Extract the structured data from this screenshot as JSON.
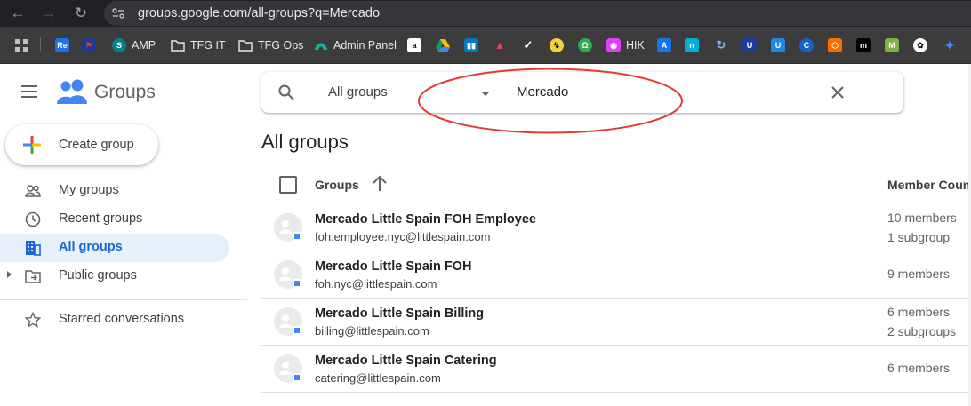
{
  "browser": {
    "url": "groups.google.com/all-groups?q=Mercado",
    "bookmarks": [
      {
        "icon": "apps-grid-icon",
        "label": ""
      },
      {
        "icon": "re-icon",
        "label": "",
        "badge": "Re",
        "color": "#1a73e8"
      },
      {
        "icon": "mlb-icon",
        "label": "",
        "color": "#1e3a8a"
      },
      {
        "icon": "sharepoint-icon",
        "label": "AMP",
        "color": "#038387"
      },
      {
        "icon": "folder-icon",
        "label": "TFG IT"
      },
      {
        "icon": "folder-icon",
        "label": "TFG Ops"
      },
      {
        "icon": "admin-panel-icon",
        "label": "Admin Panel",
        "color": "#00bfa5"
      },
      {
        "icon": "amazon-icon",
        "label": "",
        "color": "#ffffff"
      },
      {
        "icon": "drive-icon",
        "label": "",
        "color": "#0f9d58"
      },
      {
        "icon": "trello-icon",
        "label": "",
        "color": "#0079bf"
      },
      {
        "icon": "monday-icon",
        "label": "",
        "color": "#ff3d57"
      },
      {
        "icon": "check-icon",
        "label": "",
        "color": "#ffffff"
      },
      {
        "icon": "bolt-icon",
        "label": "",
        "color": "#f4d03f"
      },
      {
        "icon": "green-circle-icon",
        "label": "",
        "color": "#34a853"
      },
      {
        "icon": "hik-icon",
        "label": "HIK",
        "color": "#e040fb"
      },
      {
        "icon": "translate-icon",
        "label": "",
        "color": "#1a73e8"
      },
      {
        "icon": "n-icon",
        "label": "",
        "color": "#00b0d8"
      },
      {
        "icon": "swirl-icon",
        "label": "",
        "color": "#8ab4f8"
      },
      {
        "icon": "u-dark-icon",
        "label": "",
        "color": "#1a3e9a"
      },
      {
        "icon": "u-light-icon",
        "label": "",
        "color": "#1e88e5"
      },
      {
        "icon": "c-icon",
        "label": "",
        "color": "#1565c0"
      },
      {
        "icon": "orange-hex-icon",
        "label": "",
        "color": "#ff6d00"
      },
      {
        "icon": "mm-icon",
        "label": "",
        "color": "#000000"
      },
      {
        "icon": "m-green-icon",
        "label": "",
        "color": "#7cb342"
      },
      {
        "icon": "openai-icon",
        "label": "",
        "color": "#ffffff"
      },
      {
        "icon": "gemini-icon",
        "label": "",
        "color": "#4285f4"
      }
    ]
  },
  "app": {
    "name": "Groups",
    "create_label": "Create group"
  },
  "nav": [
    {
      "name": "nav-my-groups",
      "label": "My groups",
      "icon": "people-icon",
      "active": false
    },
    {
      "name": "nav-recent-groups",
      "label": "Recent groups",
      "icon": "clock-icon",
      "active": false
    },
    {
      "name": "nav-all-groups",
      "label": "All groups",
      "icon": "building-icon",
      "active": true
    },
    {
      "name": "nav-public-groups",
      "label": "Public groups",
      "icon": "folder-arrow-icon",
      "active": false
    },
    {
      "name": "nav-starred",
      "label": "Starred conversations",
      "icon": "star-icon",
      "active": false
    }
  ],
  "search": {
    "scope": "All groups",
    "query": "Mercado"
  },
  "main": {
    "title": "All groups",
    "columns": {
      "groups": "Groups",
      "members": "Member Count"
    }
  },
  "rows": [
    {
      "name": "Mercado Little Spain FOH Employee",
      "email": "foh.employee.nyc@littlespain.com",
      "members": "10 members",
      "subgroups": "1 subgroup"
    },
    {
      "name": "Mercado Little Spain FOH",
      "email": "foh.nyc@littlespain.com",
      "members": "9 members",
      "subgroups": ""
    },
    {
      "name": "Mercado Little Spain Billing",
      "email": "billing@littlespain.com",
      "members": "6 members",
      "subgroups": "2 subgroups"
    },
    {
      "name": "Mercado Little Spain Catering",
      "email": "catering@littlespain.com",
      "members": "6 members",
      "subgroups": ""
    }
  ],
  "colors": {
    "accent": "#1967d2",
    "annotation": "#e53935",
    "active_bg": "#e8f0fe"
  }
}
